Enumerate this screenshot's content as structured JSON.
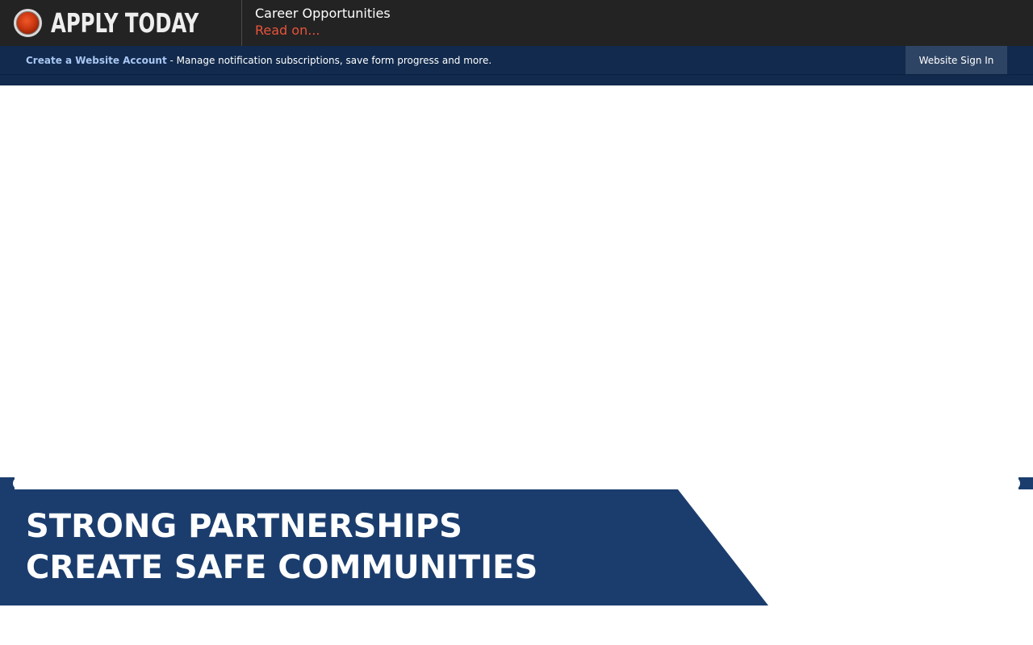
{
  "alert": {
    "title": "APPLY TODAY",
    "heading": "Career Opportunities",
    "link_label": "Read on...",
    "icon": "alert-dot-icon",
    "colors": {
      "background": "#232323",
      "link": "#e8533a"
    }
  },
  "account_bar": {
    "create_link": "Create a Website Account",
    "description": " - Manage notification subscriptions, save form progress and more.",
    "signin_label": "Website Sign In",
    "colors": {
      "background": "#112a4d",
      "link": "#a9c6f3",
      "button": "#2e4464"
    }
  },
  "banner": {
    "line1": "STRONG PARTNERSHIPS",
    "line2": "CREATE SAFE COMMUNITIES",
    "colors": {
      "background": "#1b3d6e",
      "text": "#ffffff"
    }
  }
}
